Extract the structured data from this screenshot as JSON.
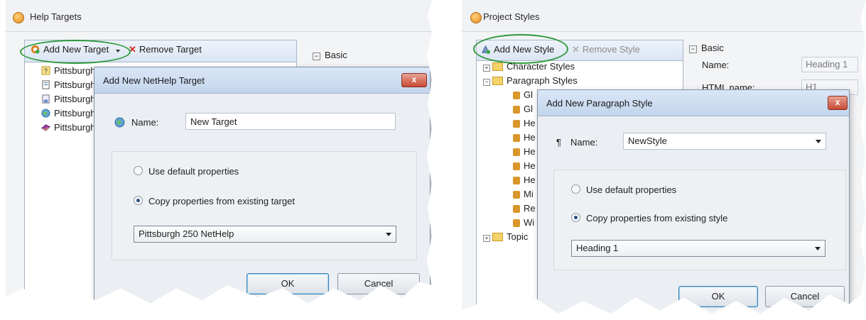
{
  "left": {
    "window_title": "Help Targets",
    "toolbar": {
      "add_label": "Add New Target",
      "remove_label": "Remove Target"
    },
    "property_section": "Basic",
    "tree_items": [
      "Pittsburgh",
      "Pittsburgh",
      "Pittsburgh",
      "Pittsburgh",
      "Pittsburgh"
    ],
    "dialog": {
      "title": "Add New NetHelp Target",
      "name_label": "Name:",
      "name_value": "New Target",
      "radio_default": "Use default properties",
      "radio_copy": "Copy properties from existing target",
      "selected_radio": "copy",
      "copy_from": "Pittsburgh 250 NetHelp",
      "ok": "OK",
      "cancel": "Cancel",
      "close_glyph": "x"
    }
  },
  "right": {
    "window_title": "Project Styles",
    "toolbar": {
      "add_label": "Add New Style",
      "remove_label": "Remove Style"
    },
    "property_section": "Basic",
    "properties": [
      {
        "name": "Name:",
        "value": "Heading 1"
      },
      {
        "name": "HTML name:",
        "value": "H1"
      }
    ],
    "tree": {
      "character_styles": "Character Styles",
      "paragraph_styles": "Paragraph Styles",
      "children": [
        "Gl",
        "Gl",
        "He",
        "He",
        "He",
        "He",
        "He",
        "Mi",
        "Re",
        "Wi"
      ],
      "topic": "Topic"
    },
    "dialog": {
      "title": "Add New Paragraph Style",
      "name_label": "Name:",
      "name_value": "NewStyle",
      "pilcrow": "¶",
      "radio_default": "Use default properties",
      "radio_copy": "Copy properties from existing style",
      "selected_radio": "copy",
      "copy_from": "Heading 1",
      "ok": "OK",
      "cancel": "Cancel",
      "close_glyph": "x"
    }
  },
  "colors": {
    "highlight_ring": "#2f9a3c",
    "toolbar": "#dbe5f3",
    "dialog_bg": "#ebeef2",
    "close_button": "#c84a34"
  }
}
